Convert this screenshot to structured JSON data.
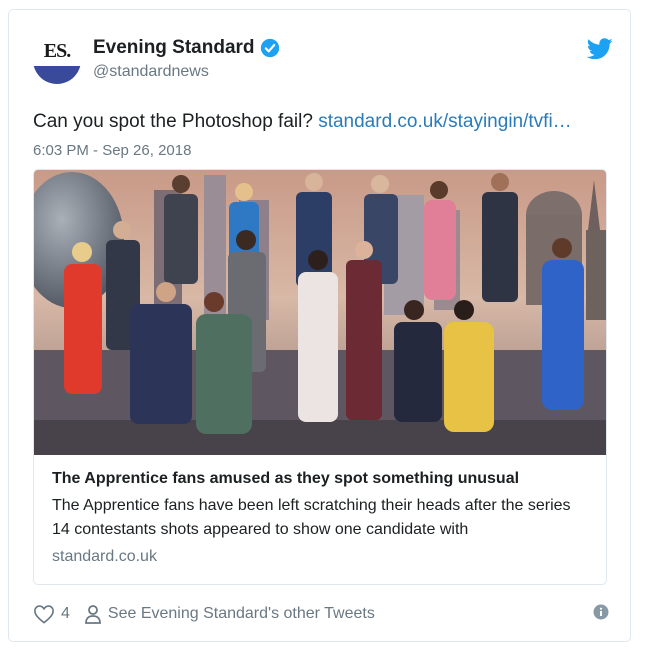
{
  "account": {
    "display_name": "Evening Standard",
    "screen_name": "@standardnews",
    "logo_text": "ES."
  },
  "tweet": {
    "text": "Can you spot the Photoshop fail? ",
    "link": "standard.co.uk/stayingin/tvfi…",
    "timestamp": "6:03 PM - Sep 26, 2018"
  },
  "card": {
    "title": "The Apprentice fans amused as they spot something unusual",
    "description": "The Apprentice fans have been left scratching their heads after the series 14 contestants shots appeared to show one candidate with",
    "domain": "standard.co.uk"
  },
  "footer": {
    "like_count": "4",
    "other_tweets": "See Evening Standard's other Tweets"
  },
  "icons": {
    "verified": "verified-badge-icon",
    "twitter_bird": "twitter-bird-icon",
    "heart": "heart-icon",
    "person": "person-icon",
    "info": "info-icon"
  },
  "colors": {
    "link": "#2b7bb9",
    "verified": "#1da1f2",
    "secondary_text": "#697882",
    "brand_band": "#3a4a9a"
  }
}
